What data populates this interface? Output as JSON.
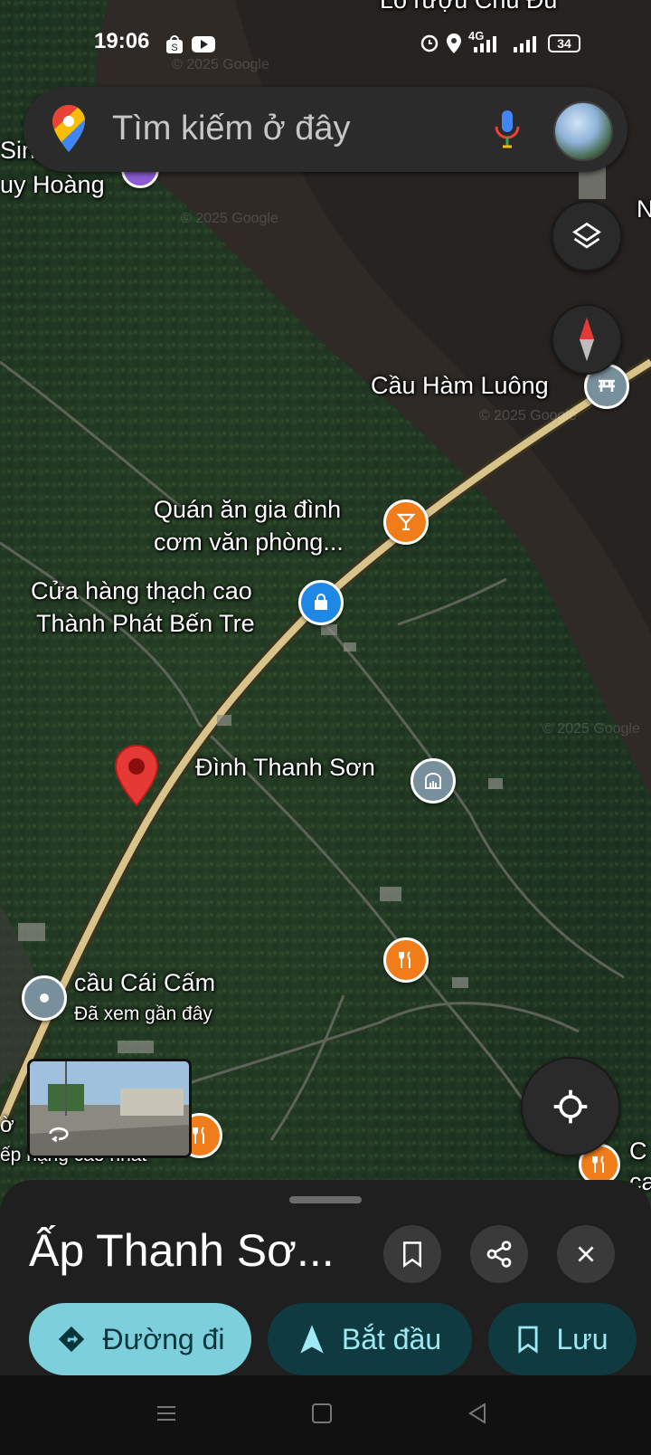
{
  "status_bar": {
    "time": "19:06",
    "network": "4G",
    "battery": "34",
    "icons": [
      "shopee-icon",
      "youtube-icon",
      "alarm-icon",
      "location-icon",
      "signal-icon",
      "battery-icon"
    ]
  },
  "search": {
    "placeholder": "Tìm kiếm ở đây",
    "icons": [
      "google-maps-pin-icon",
      "mic-icon",
      "avatar"
    ]
  },
  "map_controls": [
    "layers-icon",
    "compass-icon",
    "my-location-icon"
  ],
  "map": {
    "type": "satellite",
    "watermarks": [
      "© 2025 Google",
      "© 2025 Google",
      "© 2025 Google",
      "© 2025 Google"
    ],
    "top_edge_text": "Lò rượu Chú Đu",
    "edge_texts": [
      "Sin",
      "uy Hoàng",
      "N",
      "C",
      "ca",
      "ờ",
      "ếp hạng cao nhất"
    ],
    "labels": {
      "cau_ham_luong": "Cầu Hàm Luông",
      "quan_an_1": "Quán ăn gia đình",
      "quan_an_2": "cơm văn phòng...",
      "cua_hang_1": "Cửa hàng thạch cao",
      "cua_hang_2": "Thành Phát Bến Tre",
      "dinh_thanh_son": "Đình Thanh Sơn",
      "cau_cai_cam": "cầu Cái Cấm",
      "cau_cai_cam_sub": "Đã xem gần đây"
    },
    "poi_colors": {
      "food": "#f07d1a",
      "shop": "#1f88e5",
      "place": "#78909c",
      "bridge": "#78909c",
      "pin": "#e53935"
    }
  },
  "sheet": {
    "title": "Ấp Thanh Sơ...",
    "actions": [
      {
        "label": "Đường đi",
        "icon": "directions-icon",
        "bg": "#7ccfdb",
        "fg": "#06363c"
      },
      {
        "label": "Bắt đầu",
        "icon": "navigation-arrow-icon",
        "bg": "#0f3b40",
        "fg": "#9ee9f3"
      },
      {
        "label": "Lưu",
        "icon": "bookmark-icon",
        "bg": "#0f3b40",
        "fg": "#9ee9f3"
      }
    ]
  },
  "nav_bar": [
    "menu-icon",
    "home-icon",
    "back-icon"
  ]
}
